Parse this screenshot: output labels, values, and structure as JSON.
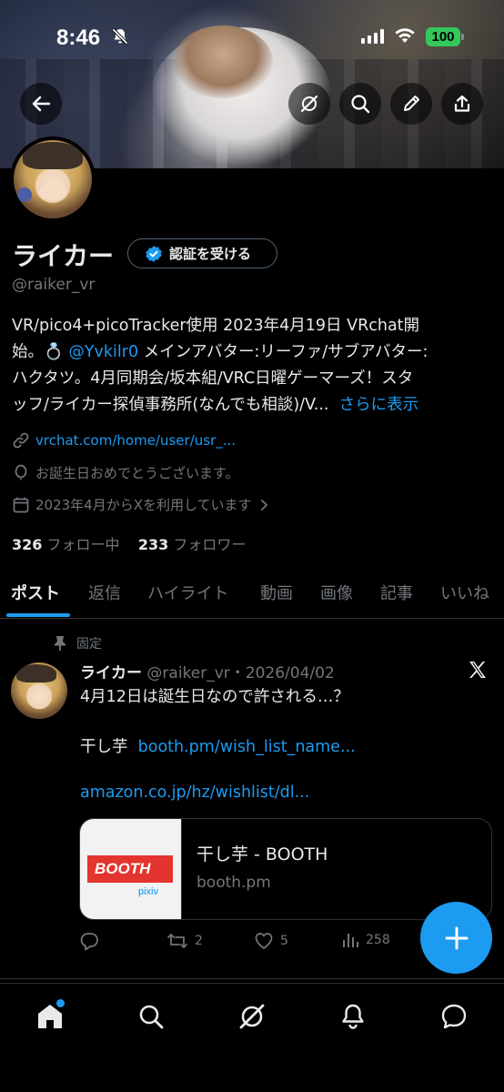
{
  "status_bar": {
    "time": "8:46",
    "battery": "100"
  },
  "profile": {
    "name": "ライカー",
    "verify_button": "認証を受ける",
    "handle": "@raiker_vr",
    "bio_line1": "VR/pico4+picoTracker使用 2023年4月19日 VRchat開",
    "bio_line2_pre": "始。💍 ",
    "bio_mention": "@Yvkilr0",
    "bio_line2_post": " メインアバター:リーファ/サブアバター:",
    "bio_line3": "ハクタツ。4月同期会/坂本組/VRC日曜ゲーマーズ！スタ",
    "bio_line4": "ッフ/ライカー探偵事務所(なんでも相談)/V...",
    "bio_more": "さらに表示",
    "website": "vrchat.com/home/user/usr_...",
    "birthday": "お誕生日おめでとうございます。",
    "joined": "2023年4月からXを利用しています",
    "following_count": "326",
    "following_label": "フォロー中",
    "followers_count": "233",
    "followers_label": "フォロワー"
  },
  "tabs": [
    "ポスト",
    "返信",
    "ハイライト",
    "動画",
    "画像",
    "記事",
    "いいね"
  ],
  "tweet": {
    "pinned_label": "固定",
    "name": "ライカー",
    "handle_date": "@raiker_vr・2026/04/02",
    "text1": "4月12日は誕生日なので許される…？",
    "text2_pre": "干し芋",
    "text2_link": "booth.pm/wish_list_name...",
    "text3_link": "amazon.co.jp/hz/wishlist/dl...",
    "card": {
      "image_logo": "BOOTH",
      "image_sub": "pixiv",
      "title": "干し芋 - BOOTH",
      "domain": "booth.pm"
    },
    "retweets": "2",
    "likes": "5",
    "views": "258"
  },
  "colors": {
    "accent": "#1d9bf0",
    "background": "#000000",
    "muted": "#71767b",
    "battery": "#34c759"
  }
}
